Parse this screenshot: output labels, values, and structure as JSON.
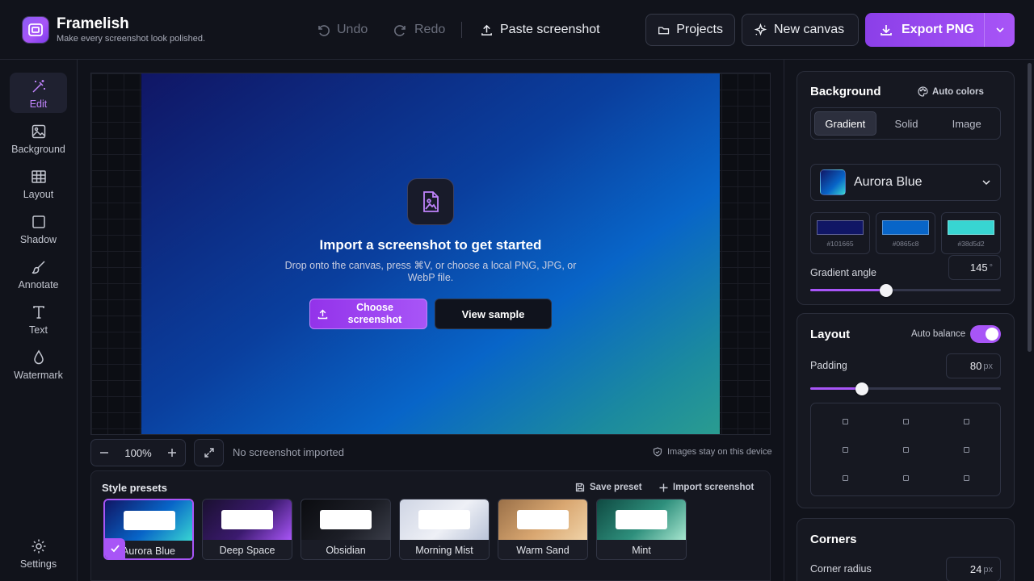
{
  "app": {
    "name": "Framelish",
    "tagline": "Make every screenshot look polished."
  },
  "toolbar": {
    "undo": "Undo",
    "redo": "Redo",
    "paste": "Paste screenshot",
    "projects": "Projects",
    "new_canvas": "New canvas",
    "export": "Export PNG"
  },
  "rail": {
    "items": [
      {
        "label": "Edit",
        "icon": "magic-wand-icon",
        "active": true
      },
      {
        "label": "Background",
        "icon": "image-icon"
      },
      {
        "label": "Layout",
        "icon": "grid-icon"
      },
      {
        "label": "Shadow",
        "icon": "square-icon"
      },
      {
        "label": "Annotate",
        "icon": "brush-icon"
      },
      {
        "label": "Text",
        "icon": "text-icon"
      },
      {
        "label": "Watermark",
        "icon": "drop-icon"
      }
    ],
    "settings": "Settings"
  },
  "canvas": {
    "title": "Import a screenshot to get started",
    "subtitle": "Drop onto the canvas, press ⌘V, or choose a local PNG, JPG, or WebP file.",
    "choose": "Choose screenshot",
    "sample": "View sample"
  },
  "status": {
    "zoom": "100%",
    "no_screenshot": "No screenshot imported",
    "privacy": "Images stay on this device"
  },
  "presets": {
    "title": "Style presets",
    "save": "Save preset",
    "import": "Import screenshot",
    "items": [
      {
        "name": "Aurora Blue",
        "selected": true
      },
      {
        "name": "Deep Space"
      },
      {
        "name": "Obsidian"
      },
      {
        "name": "Morning Mist"
      },
      {
        "name": "Warm Sand"
      },
      {
        "name": "Mint"
      }
    ]
  },
  "background": {
    "title": "Background",
    "auto_colors": "Auto colors",
    "tabs": [
      "Gradient",
      "Solid",
      "Image"
    ],
    "active_tab": "Gradient",
    "preset": "Aurora Blue",
    "stops": [
      "#101665",
      "#0865c8",
      "#38d5d2"
    ],
    "angle_label": "Gradient angle",
    "angle": "145",
    "angle_unit": "°",
    "angle_fraction": 0.4
  },
  "layout": {
    "title": "Layout",
    "auto_balance": "Auto balance",
    "auto_balance_on": true,
    "padding_label": "Padding",
    "padding": "80",
    "padding_unit": "px",
    "padding_fraction": 0.27
  },
  "corners": {
    "title": "Corners",
    "radius_label": "Corner radius",
    "radius": "24",
    "radius_unit": "px"
  },
  "colors": {
    "accent": "#a855f7"
  }
}
